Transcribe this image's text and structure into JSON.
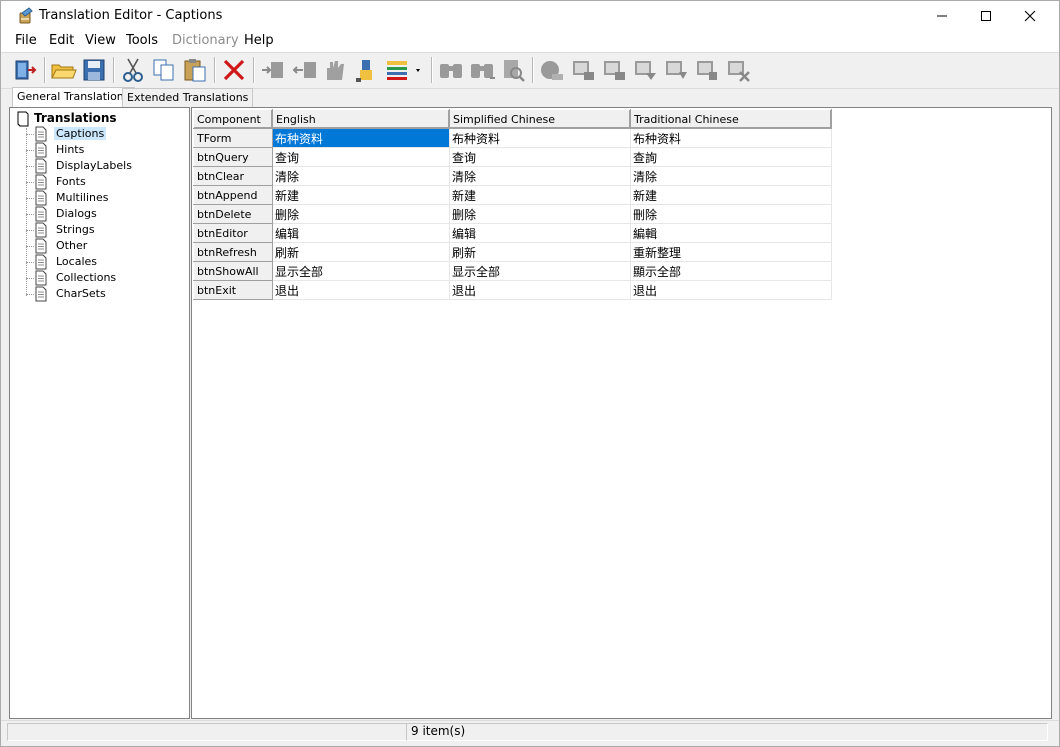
{
  "window": {
    "title": "Translation Editor - Captions",
    "minimize_label": "—",
    "maximize_label": "☐",
    "close_label": "✕"
  },
  "menu": [
    "File",
    "Edit",
    "View",
    "Tools",
    "Dictionary",
    "Help"
  ],
  "menu_disabled": [
    "Dictionary"
  ],
  "toolbar": {
    "icons": [
      "exit-icon",
      "open-folder-icon",
      "save-icon",
      "cut-icon",
      "copy-icon",
      "paste-icon",
      "delete-icon",
      "move-right-icon",
      "move-left-icon",
      "hand-icon",
      "highlight-icon",
      "list-options-icon",
      "find-icon",
      "find-next-icon",
      "find-replace-icon",
      "translate-icon",
      "translate-down-icon",
      "translate-up-icon",
      "translate-next-icon",
      "translate-prev-icon",
      "translate-clear-icon"
    ]
  },
  "tabs": [
    "General Translations",
    "Extended Translations"
  ],
  "tree": {
    "root": "Translations",
    "items": [
      "Captions",
      "Hints",
      "DisplayLabels",
      "Fonts",
      "Multilines",
      "Dialogs",
      "Strings",
      "Other",
      "Locales",
      "Collections",
      "CharSets"
    ],
    "selected": "Captions"
  },
  "grid": {
    "columns": [
      "Component",
      "English",
      "Simplified Chinese",
      "Traditional Chinese"
    ],
    "rows": [
      {
        "component": "TForm",
        "english": "布种资料",
        "simplified": "布种资料",
        "traditional": "布种资料"
      },
      {
        "component": "btnQuery",
        "english": "查询",
        "simplified": "查询",
        "traditional": "查詢"
      },
      {
        "component": "btnClear",
        "english": "清除",
        "simplified": "清除",
        "traditional": "清除"
      },
      {
        "component": "btnAppend",
        "english": "新建",
        "simplified": "新建",
        "traditional": "新建"
      },
      {
        "component": "btnDelete",
        "english": "删除",
        "simplified": "删除",
        "traditional": "刪除"
      },
      {
        "component": "btnEditor",
        "english": "编辑",
        "simplified": "编辑",
        "traditional": "編輯"
      },
      {
        "component": "btnRefresh",
        "english": "刷新",
        "simplified": "刷新",
        "traditional": "重新整理"
      },
      {
        "component": "btnShowAll",
        "english": "显示全部",
        "simplified": "显示全部",
        "traditional": "顯示全部"
      },
      {
        "component": "btnExit",
        "english": "退出",
        "simplified": "退出",
        "traditional": "退出"
      }
    ]
  },
  "status": {
    "count_text": "9 item(s)"
  },
  "colors": {
    "selection": "#0078d7",
    "tree_selection": "#cce8ff"
  }
}
